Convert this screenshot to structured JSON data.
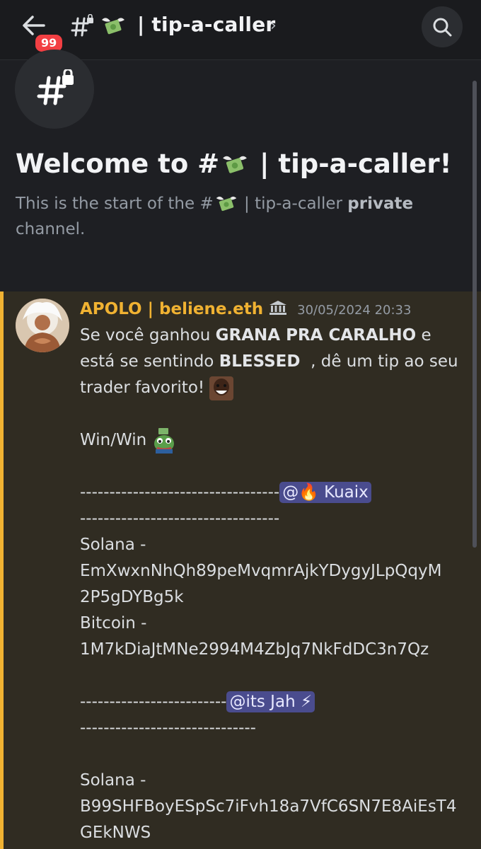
{
  "header": {
    "badge_count": "99",
    "channel_title": "| tip-a-caller",
    "chevron": "›"
  },
  "welcome": {
    "title_prefix": "Welcome to #",
    "title_suffix": " | tip-a-caller!",
    "sub_prefix": "This is the start of the #",
    "sub_middle": " | tip-a-caller ",
    "sub_bold": "private",
    "sub_end": " channel."
  },
  "message": {
    "author": "APOLO | beliene.eth",
    "timestamp": "30/05/2024 20:33",
    "line1_a": "Se você ganhou ",
    "line1_bold": "GRANA PRA CARALHO",
    "line1_b": " e",
    "line2_a": "está se sentindo ",
    "line2_bold": "BLESSED",
    "line2_b": "  , dê um tip ao seu",
    "line3": "trader favorito! ",
    "winwin": "Win/Win ",
    "dash_long": "----------------------------------",
    "mention1": "@🔥 Kuaix",
    "dash_under1": "----------------------------------",
    "sol_label1": "Solana -",
    "sol_addr1a": "EmXwxnNhQh89peMvqmrAjkYDygyJLpQqyM",
    "sol_addr1b": "2P5gDYBg5k",
    "btc_label1": "Bitcoin -",
    "btc_addr1": "1M7kDiaJtMNe2994M4ZbJq7NkFdDC3n7Qz",
    "dash_short": "-------------------------",
    "mention2": "@its Jah ⚡",
    "dash_under2": "------------------------------",
    "sol_label2": "Solana -",
    "sol_addr2a": "B99SHFBoyESpSc7iFvh18a7VfC6SN7E8AiEsT4",
    "sol_addr2b": "GEkNWS"
  },
  "colors": {
    "accent_highlight": "#f0b232",
    "mention_bg": "#4a4c8e",
    "badge": "#f23f43"
  },
  "icons": {
    "back": "arrow-left-icon",
    "search": "search-icon",
    "channel": "private-hash-icon",
    "money": "money-with-wings-emoji",
    "tag": "bank-building-icon"
  }
}
